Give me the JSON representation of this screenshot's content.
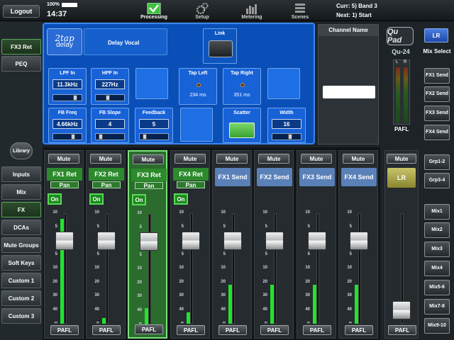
{
  "topbar": {
    "logout_label": "Logout",
    "battery": "100%",
    "clock": "14:37",
    "tabs": [
      {
        "label": "Processing",
        "icon": "processing-check-icon",
        "active": true
      },
      {
        "label": "Setup",
        "icon": "gears-icon",
        "active": false
      },
      {
        "label": "Metering",
        "icon": "meter-bars-icon",
        "active": false
      },
      {
        "label": "Scenes",
        "icon": "scenes-stack-icon",
        "active": false
      }
    ],
    "current": "Curr: 5) Band 3",
    "next": "Next: 1) Start"
  },
  "sidebar": {
    "top_items": [
      {
        "label": "FX3 Ret",
        "selected": true
      },
      {
        "label": "PEQ",
        "selected": false
      }
    ],
    "library_label": "Library",
    "layers": [
      {
        "label": "Inputs",
        "selected": false
      },
      {
        "label": "Mix",
        "selected": false
      },
      {
        "label": "FX",
        "selected": true
      },
      {
        "label": "DCAs",
        "selected": false
      },
      {
        "label": "Mute Groups",
        "selected": false
      },
      {
        "label": "Soft Keys",
        "selected": false
      },
      {
        "label": "Custom 1",
        "selected": false
      },
      {
        "label": "Custom 2",
        "selected": false
      },
      {
        "label": "Custom 3",
        "selected": false
      }
    ]
  },
  "fx_panel": {
    "logo_line1": "2tap",
    "logo_line2": "delay",
    "preset_name": "Delay Vocal",
    "link_label": "Link",
    "params": {
      "lpf_in": {
        "label": "LPF In",
        "value": "11.3kHz"
      },
      "hpf_in": {
        "label": "HPF In",
        "value": "227Hz"
      },
      "tap_left": {
        "label": "Tap Left",
        "value": "234 ms"
      },
      "tap_right": {
        "label": "Tap Right",
        "value": "351 ms"
      },
      "fb_freq": {
        "label": "FB Freq",
        "value": "4.66kHz"
      },
      "fb_slope": {
        "label": "FB Slope",
        "value": "4"
      },
      "feedback": {
        "label": "Feedback",
        "value": "5"
      },
      "scatter": {
        "label": "Scatter",
        "on": true
      },
      "width": {
        "label": "Width",
        "value": "16"
      }
    },
    "channel_name_label": "Channel Name"
  },
  "master": {
    "logo": "Qu Pad",
    "model": "Qu-24",
    "meter_labels": [
      "L",
      "R"
    ],
    "pafl_label": "PAFL",
    "lr_label": "LR",
    "mix_select_label": "Mix Select",
    "fx_sends": [
      "FX1 Send",
      "FX2 Send",
      "FX3 Send",
      "FX4 Send"
    ],
    "groups": [
      "Grp1-2",
      "Grp3-4"
    ],
    "mixes": [
      "Mix1",
      "Mix2",
      "Mix3",
      "Mix4",
      "Mix5-6",
      "Mix7-8",
      "Mix9-10"
    ],
    "lr_strip": {
      "mute_label": "Mute",
      "name": "LR",
      "pafl": "PAFL",
      "fader_level": 0.12
    }
  },
  "strips": [
    {
      "name": "FX1 Ret",
      "type": "fx",
      "mute": "Mute",
      "pan": "Pan",
      "on": "On",
      "pafl": "PAFL",
      "selected": false,
      "fader_level": 0.75,
      "meter_level": 0.95
    },
    {
      "name": "FX2 Ret",
      "type": "fx",
      "mute": "Mute",
      "pan": "Pan",
      "on": "On",
      "pafl": "PAFL",
      "selected": false,
      "fader_level": 0.75,
      "meter_level": 0.05
    },
    {
      "name": "FX3 Ret",
      "type": "fx",
      "mute": "Mute",
      "pan": "Pan",
      "on": "On",
      "pafl": "PAFL",
      "selected": true,
      "fader_level": 0.75,
      "meter_level": 0.15
    },
    {
      "name": "FX4 Ret",
      "type": "fx",
      "mute": "Mute",
      "pan": "Pan",
      "on": "On",
      "pafl": "PAFL",
      "selected": false,
      "fader_level": 0.75,
      "meter_level": 0.1
    },
    {
      "name": "FX1 Send",
      "type": "send",
      "mute": "Mute",
      "pafl": "PAFL",
      "selected": false,
      "fader_level": 0.75,
      "meter_level": 0.35
    },
    {
      "name": "FX2 Send",
      "type": "send",
      "mute": "Mute",
      "pafl": "PAFL",
      "selected": false,
      "fader_level": 0.75,
      "meter_level": 0.35
    },
    {
      "name": "FX3 Send",
      "type": "send",
      "mute": "Mute",
      "pafl": "PAFL",
      "selected": false,
      "fader_level": 0.75,
      "meter_level": 0.35
    },
    {
      "name": "FX4 Send",
      "type": "send",
      "mute": "Mute",
      "pafl": "PAFL",
      "selected": false,
      "fader_level": 0.75,
      "meter_level": 0.35
    }
  ],
  "scale_labels": [
    "10",
    "5",
    "0",
    "5",
    "10",
    "20",
    "30",
    "40",
    "∞"
  ]
}
